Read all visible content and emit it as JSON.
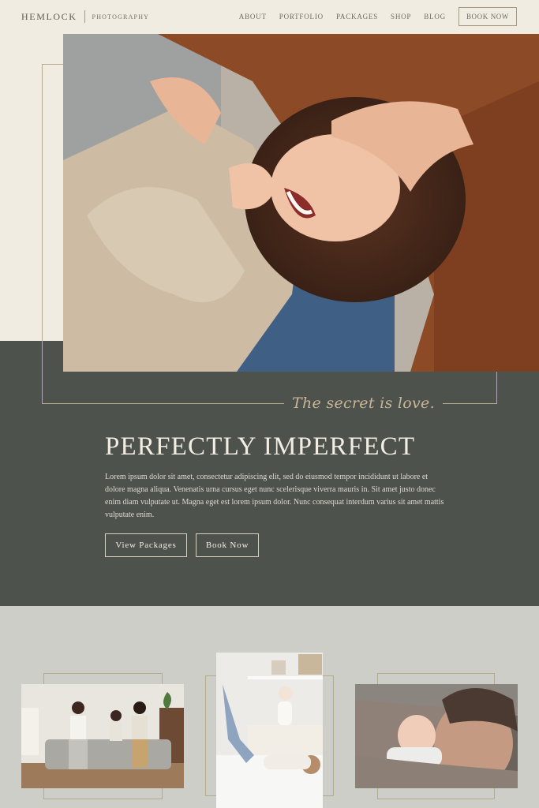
{
  "brand": {
    "name": "HEMLOCK",
    "tagline": "PHOTOGRAPHY"
  },
  "nav": {
    "items": [
      "ABOUT",
      "PORTFOLIO",
      "PACKAGES",
      "SHOP",
      "BLOG"
    ],
    "cta": "BOOK NOW"
  },
  "hero": {
    "script_line": "The secret is love.",
    "headline": "PERFECTLY IMPERFECT",
    "body": "Lorem ipsum dolor sit amet, consectetur adipiscing elit, sed do eiusmod tempor incididunt ut labore et dolore magna aliqua. Venenatis urna cursus eget nunc scelerisque viverra mauris in. Sit amet justo donec enim diam vulputate ut. Magna eget est lorem ipsum dolor. Nunc consequat interdum varius sit amet mattis vulputate enim.",
    "buttons": {
      "primary": "View Packages",
      "secondary": "Book Now"
    }
  },
  "colors": {
    "cream": "#f1ece2",
    "charcoal_green": "#4e524c",
    "sage_gray": "#cdcec7",
    "tan_accent": "#c9b595"
  }
}
